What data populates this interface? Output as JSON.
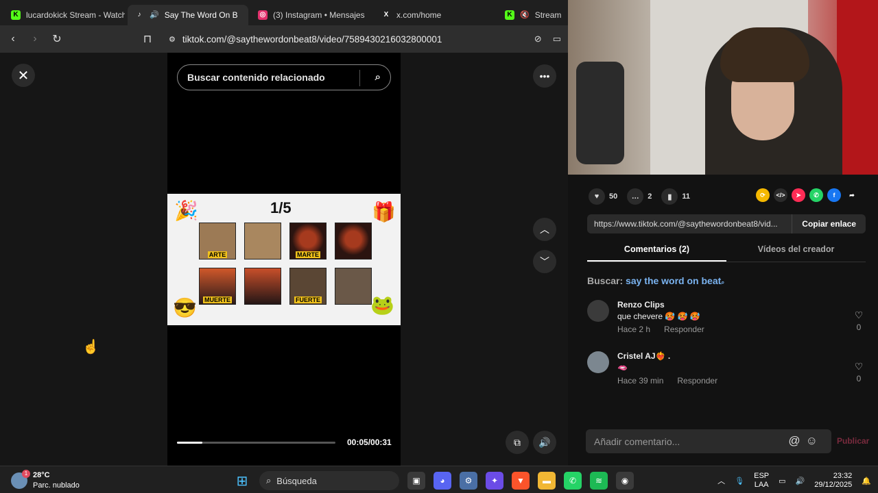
{
  "browser": {
    "tabs": [
      {
        "label": "lucardokick Stream - Watch",
        "fav": "K",
        "color": "#53fc18",
        "active": false
      },
      {
        "label": "Say The Word On B",
        "fav": "♪",
        "color": "#111111",
        "active": true
      },
      {
        "label": "(3) Instagram • Mensajes",
        "fav": "◎",
        "color": "#e1306c",
        "active": false
      },
      {
        "label": "x.com/home",
        "fav": "X",
        "color": "#000000",
        "active": false
      },
      {
        "label": "Stream - ",
        "fav": "K",
        "color": "#53fc18",
        "active": false
      }
    ],
    "url": "tiktok.com/@saythewordonbeat8/video/7589430216032800001"
  },
  "video": {
    "search_placeholder": "Buscar contenido relacionado",
    "game": {
      "count": "1/5",
      "labels": [
        "ARTE",
        "",
        "MARTE",
        "",
        "MUERTE",
        "",
        "FUERTE",
        ""
      ]
    },
    "progress": 0.16,
    "time": "00:05/00:31"
  },
  "panel": {
    "likes": "50",
    "comments_count": "2",
    "saves": "11",
    "link": "https://www.tiktok.com/@saythewordonbeat8/vid...",
    "copy_label": "Copiar enlace",
    "tab_comments": "Comentarios (2)",
    "tab_creator": "Vídeos del creador",
    "search_prefix": "Buscar:",
    "search_query": "say the word on beat",
    "comments": [
      {
        "name": "Renzo Clips",
        "text": "que chevere 🥵 🥵 🥵",
        "time": "Hace 2 h",
        "reply": "Responder",
        "likes": "0"
      },
      {
        "name": "Cristel AJ❤️‍🔥 .",
        "text": "🫦",
        "time": "Hace 39 min",
        "reply": "Responder",
        "likes": "0"
      }
    ],
    "composer_placeholder": "Añadir comentario...",
    "publish_label": "Publicar"
  },
  "taskbar": {
    "temp": "28°C",
    "weather": "Parc. nublado",
    "search": "Búsqueda",
    "lang_1": "ESP",
    "lang_2": "LAA",
    "time": "23:32",
    "date": "29/12/2025",
    "weather_badge": "1"
  }
}
